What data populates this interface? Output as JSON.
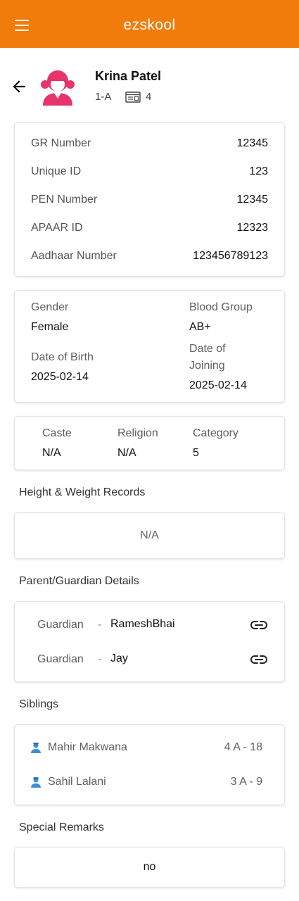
{
  "app": {
    "title": "ezskool"
  },
  "student": {
    "name": "Krina Patel",
    "class": "1-A",
    "roll": "4"
  },
  "ids": [
    {
      "label": "GR Number",
      "value": "12345"
    },
    {
      "label": "Unique ID",
      "value": "123"
    },
    {
      "label": "PEN Number",
      "value": "12345"
    },
    {
      "label": "APAAR ID",
      "value": "12323"
    },
    {
      "label": "Aadhaar Number",
      "value": "123456789123"
    }
  ],
  "personal": {
    "gender_label": "Gender",
    "gender": "Female",
    "blood_label": "Blood Group",
    "blood": "AB+",
    "dob_label": "Date of Birth",
    "dob": "2025-02-14",
    "doj_label": "Date of Joining",
    "doj": "2025-02-14"
  },
  "social": {
    "caste_label": "Caste",
    "caste": "N/A",
    "religion_label": "Religion",
    "religion": "N/A",
    "category_label": "Category",
    "category": "5"
  },
  "height_weight": {
    "title": "Height & Weight Records",
    "value": "N/A"
  },
  "guardians": {
    "title": "Parent/Guardian Details",
    "items": [
      {
        "relation": "Guardian",
        "separator": "-",
        "name": "RameshBhai"
      },
      {
        "relation": "Guardian",
        "separator": "-",
        "name": "Jay"
      }
    ]
  },
  "siblings": {
    "title": "Siblings",
    "items": [
      {
        "name": "Mahir Makwana",
        "class_roll": "4 A - 18"
      },
      {
        "name": "Sahil Lalani",
        "class_roll": "3 A - 9"
      }
    ]
  },
  "remarks": {
    "title": "Special Remarks",
    "value": "no"
  },
  "colors": {
    "accent": "#f07c0b",
    "avatar": "#e8336b",
    "person_icon": "#3a8fd6"
  },
  "icons": [
    "menu-icon",
    "back-arrow-icon",
    "student-avatar-icon",
    "id-card-icon",
    "link-icon",
    "person-icon"
  ]
}
